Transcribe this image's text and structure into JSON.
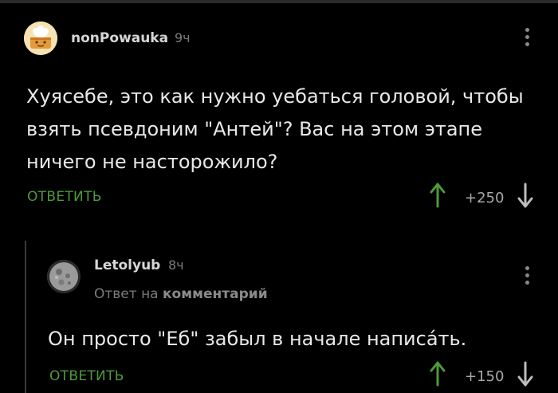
{
  "colors": {
    "background": "#000000",
    "accent_green": "#4e9a3a",
    "text": "#e8e8e8",
    "muted": "#7a7a7a"
  },
  "comments": [
    {
      "username": "nonPowauka",
      "time": "9ч",
      "text": "Хуясебе, это как нужно уебаться головой, чтобы взять псевдоним \"Антей\"? Вас на этом этапе ничего не насторожило?",
      "reply_label": "ОТВЕТИТЬ",
      "score": "+250",
      "icons": {
        "avatar": "cartoon-avatar-icon",
        "menu": "kebab-menu-icon",
        "up": "arrow-up-icon",
        "down": "arrow-down-icon"
      }
    },
    {
      "username": "Letolyub",
      "time": "8ч",
      "reply_to_prefix": "Ответ на",
      "reply_to_link": "комментарий",
      "text": "Он просто \"Еб\" забыл в начале написáть.",
      "reply_label": "ОТВЕТИТЬ",
      "score": "+150",
      "icons": {
        "avatar": "moon-avatar-icon",
        "menu": "kebab-menu-icon",
        "up": "arrow-up-icon",
        "down": "arrow-down-icon"
      }
    }
  ]
}
